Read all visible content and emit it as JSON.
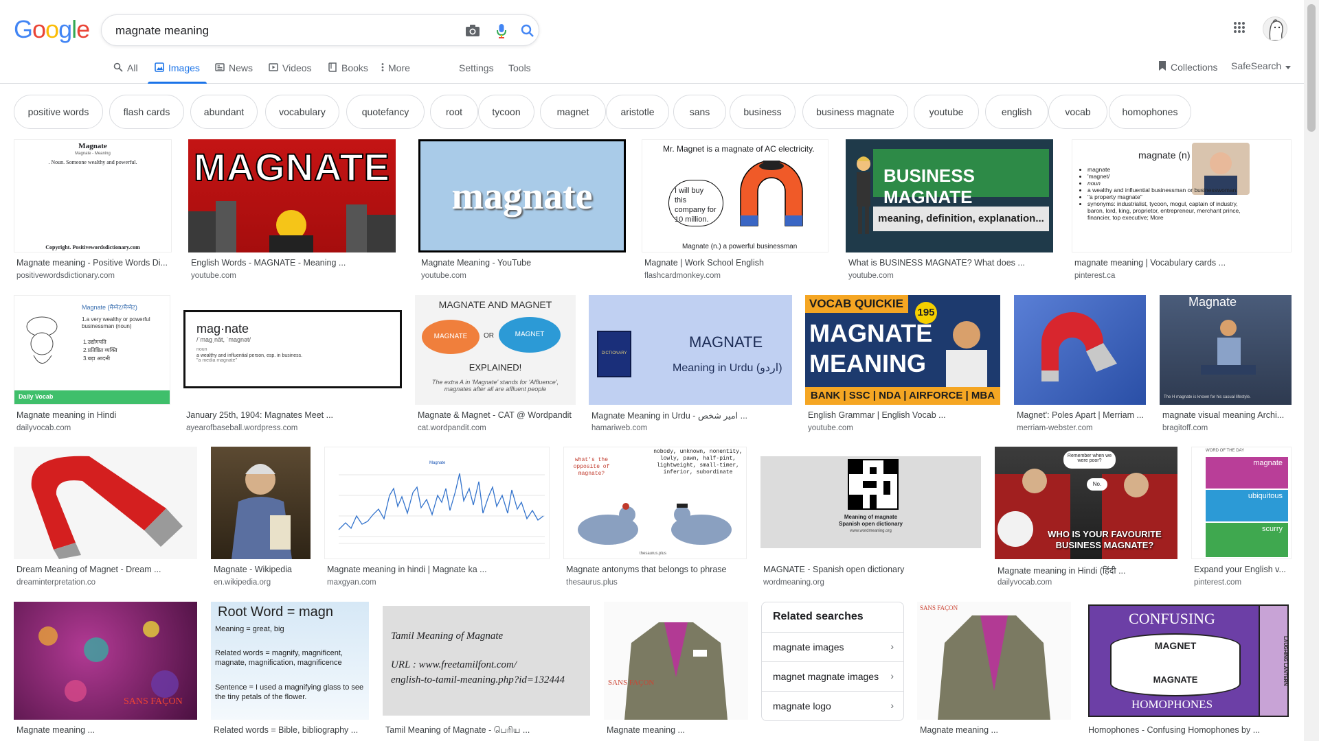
{
  "logo": {
    "letters": [
      "G",
      "o",
      "o",
      "g",
      "l",
      "e"
    ],
    "colors": [
      "#4285F4",
      "#EA4335",
      "#FBBC05",
      "#4285F4",
      "#34A853",
      "#EA4335"
    ]
  },
  "search": {
    "query": "magnate meaning",
    "placeholder": "Search"
  },
  "tabs": [
    {
      "label": "All",
      "icon": "search-icon"
    },
    {
      "label": "Images",
      "icon": "image-icon",
      "active": true
    },
    {
      "label": "News",
      "icon": "news-icon"
    },
    {
      "label": "Videos",
      "icon": "video-icon"
    },
    {
      "label": "Books",
      "icon": "book-icon"
    },
    {
      "label": "More",
      "icon": "more-vert-icon"
    }
  ],
  "tools": {
    "settings": "Settings",
    "tools": "Tools",
    "collections": "Collections",
    "safesearch": "SafeSearch"
  },
  "chips": [
    "positive words",
    "flash cards",
    "abundant",
    "vocabulary",
    "quotefancy",
    "root",
    "tycoon",
    "magnet",
    "aristotle",
    "sans",
    "business",
    "business magnate",
    "youtube",
    "english",
    "vocab",
    "homophones"
  ],
  "results": [
    {
      "caption": "Magnate meaning - Positive Words Di...",
      "source": "positivewordsdictionary.com",
      "image": {
        "title": "Magnate",
        "sub": "Magnate - Meaning",
        "body": ". Noun. Someone wealthy and powerful.",
        "footer": "Copyright. Positivewordsdictionary.com"
      }
    },
    {
      "caption": "English Words - MAGNATE - Meaning ...",
      "source": "youtube.com",
      "image": {
        "title": "MAGNATE"
      }
    },
    {
      "caption": "Magnate Meaning - YouTube",
      "source": "youtube.com",
      "image": {
        "title": "magnate"
      }
    },
    {
      "caption": "Magnate | Work School English",
      "source": "flashcardmonkey.com",
      "image": {
        "line1": "Mr. Magnet is a magnate of AC electricity.",
        "bubble": "I will buy this company for 10 million.",
        "footer": "Magnate (n.) a powerful businessman"
      }
    },
    {
      "caption": "What is BUSINESS MAGNATE? What does ...",
      "source": "youtube.com",
      "image": {
        "title": "BUSINESS MAGNATE",
        "sub": "meaning, definition, explanation..."
      }
    },
    {
      "caption": "magnate meaning | Vocabulary cards ...",
      "source": "pinterest.ca",
      "image": {
        "title": "magnate (n)",
        "lines": [
          "magnate",
          "'magnet/",
          "noun",
          "a wealthy and influential businessman or businesswoman.",
          "\"a property magnate\"",
          "synonyms: industrialist, tycoon, mogul, captain of industry, baron, lord, king, proprietor, entrepreneur, merchant prince, financier, top executive; More"
        ]
      }
    },
    {
      "caption": "Magnate meaning in Hindi",
      "source": "dailyvocab.com",
      "image": {
        "title": "Magnate (मैग्नेट/मैग्नेट)",
        "lines": [
          "1.a very wealthy or powerful businessman (noun)",
          "1.उद्योगपति",
          "2.प्रतिष्ठित व्यक्ति",
          "3.बड़ा आदमी"
        ],
        "footer": "Daily Vocab"
      }
    },
    {
      "caption": "January 25th, 1904: Magnates Meet ...",
      "source": "ayearofbaseball.wordpress.com",
      "image": {
        "title": "mag·nate",
        "sub": "/ˈmaɡˌnāt, ˈmaɡnət/",
        "body": "noun",
        "line": "a wealthy and influential person, esp. in business.",
        "ex": "\"a media magnate\""
      }
    },
    {
      "caption": "Magnate & Magnet - CAT @ Wordpandit",
      "source": "cat.wordpandit.com",
      "image": {
        "title": "MAGNATE AND MAGNET",
        "a": "MAGNATE",
        "or": "OR",
        "b": "MAGNET",
        "sub": "EXPLAINED!",
        "body": "The extra A in 'Magnate' stands for 'Affluence', magnates after all are affluent people"
      }
    },
    {
      "caption": "Magnate Meaning in Urdu - امیر شخص ...",
      "source": "hamariweb.com",
      "image": {
        "title": "MAGNATE",
        "sub": "Meaning in Urdu (اردو)",
        "book": "DICTIONARY"
      }
    },
    {
      "caption": "English Grammar | English Vocab ...",
      "source": "youtube.com",
      "image": {
        "tag": "VOCAB QUICKIE",
        "num": "195",
        "title": "MAGNATE MEANING",
        "footer": "BANK | SSC | NDA | AIRFORCE | MBA"
      }
    },
    {
      "caption": "Magnet': Poles Apart | Merriam ...",
      "source": "merriam-webster.com",
      "image": {}
    },
    {
      "caption": "magnate visual meaning Archi...",
      "source": "bragitoff.com",
      "image": {
        "title": "Magnate",
        "footer": "The H magnate is known for his casual lifestyle."
      }
    },
    {
      "caption": "Dream Meaning of Magnet - Dream ...",
      "source": "dreaminterpretation.co",
      "image": {}
    },
    {
      "caption": "Magnate - Wikipedia",
      "source": "en.wikipedia.org",
      "image": {}
    },
    {
      "caption": "Magnate meaning in hindi | Magnate ka ...",
      "source": "maxgyan.com",
      "image": {
        "legend": "Magnate"
      }
    },
    {
      "caption": "Magnate antonyms that belongs to phrase",
      "source": "thesaurus.plus",
      "image": {
        "left": "what's the opposite of magnate?",
        "right": "nobody, unknown, nonentity, lowly, pawn, half-pint, lightweight, small-timer, inferior, subordinate",
        "footer": "thesaurus.plus"
      }
    },
    {
      "caption": "MAGNATE - Spanish open dictionary",
      "source": "wordmeaning.org",
      "image": {
        "title": "Meaning of magnate",
        "sub": "Spanish open dictionary",
        "footer": "www.wordmeaning.org"
      }
    },
    {
      "caption": "Magnate meaning in Hindi (हिंदी ...",
      "source": "dailyvocab.com",
      "image": {
        "bubble1": "Remember when we were poor?",
        "bubble2": "No.",
        "title": "WHO IS YOUR FAVOURITE BUSINESS MAGNATE?"
      }
    },
    {
      "caption": "Expand your English v...",
      "source": "pinterest.com",
      "image": {
        "tag": "WORD OF THE DAY",
        "w1": "magnate",
        "w2": "ubiquitous",
        "w3": "scurry"
      }
    },
    {
      "caption": "Magnate meaning ...",
      "source": "",
      "image": {
        "mark": "SANS FAÇON"
      }
    },
    {
      "caption": "Related words = Bible, bibliography ...",
      "source": "",
      "image": {
        "title": "Root Word = magn",
        "l1": "Meaning = great, big",
        "l2": "Related words = magnify, magnificent, magnate, magnification, magnificence",
        "l3": "Sentence = I used a magnifying glass to see the tiny petals of the flower."
      }
    },
    {
      "caption": "Tamil Meaning of Magnate - பெரிய ...",
      "source": "",
      "image": {
        "title": "Tamil Meaning of Magnate",
        "l1": "URL : www.freetamilfont.com/",
        "l2": "english-to-tamil-meaning.php?id=132444"
      }
    },
    {
      "caption": "Magnate meaning ...",
      "source": "",
      "image": {
        "mark": "SANS FAÇON"
      }
    },
    {
      "caption": "Magnate meaning ...",
      "source": "",
      "image": {
        "mark": "SANS FAÇON"
      }
    },
    {
      "caption": "Homophones - Confusing Homophones by ...",
      "source": "",
      "image": {
        "top": "CONFUSING",
        "a": "MAGNET",
        "b": "MAGNATE",
        "bottom": "HOMOPHONES",
        "side": "LAUGHING LANTERN"
      }
    }
  ],
  "related": {
    "title": "Related searches",
    "items": [
      "magnate images",
      "magnet magnate images",
      "magnate logo"
    ]
  }
}
